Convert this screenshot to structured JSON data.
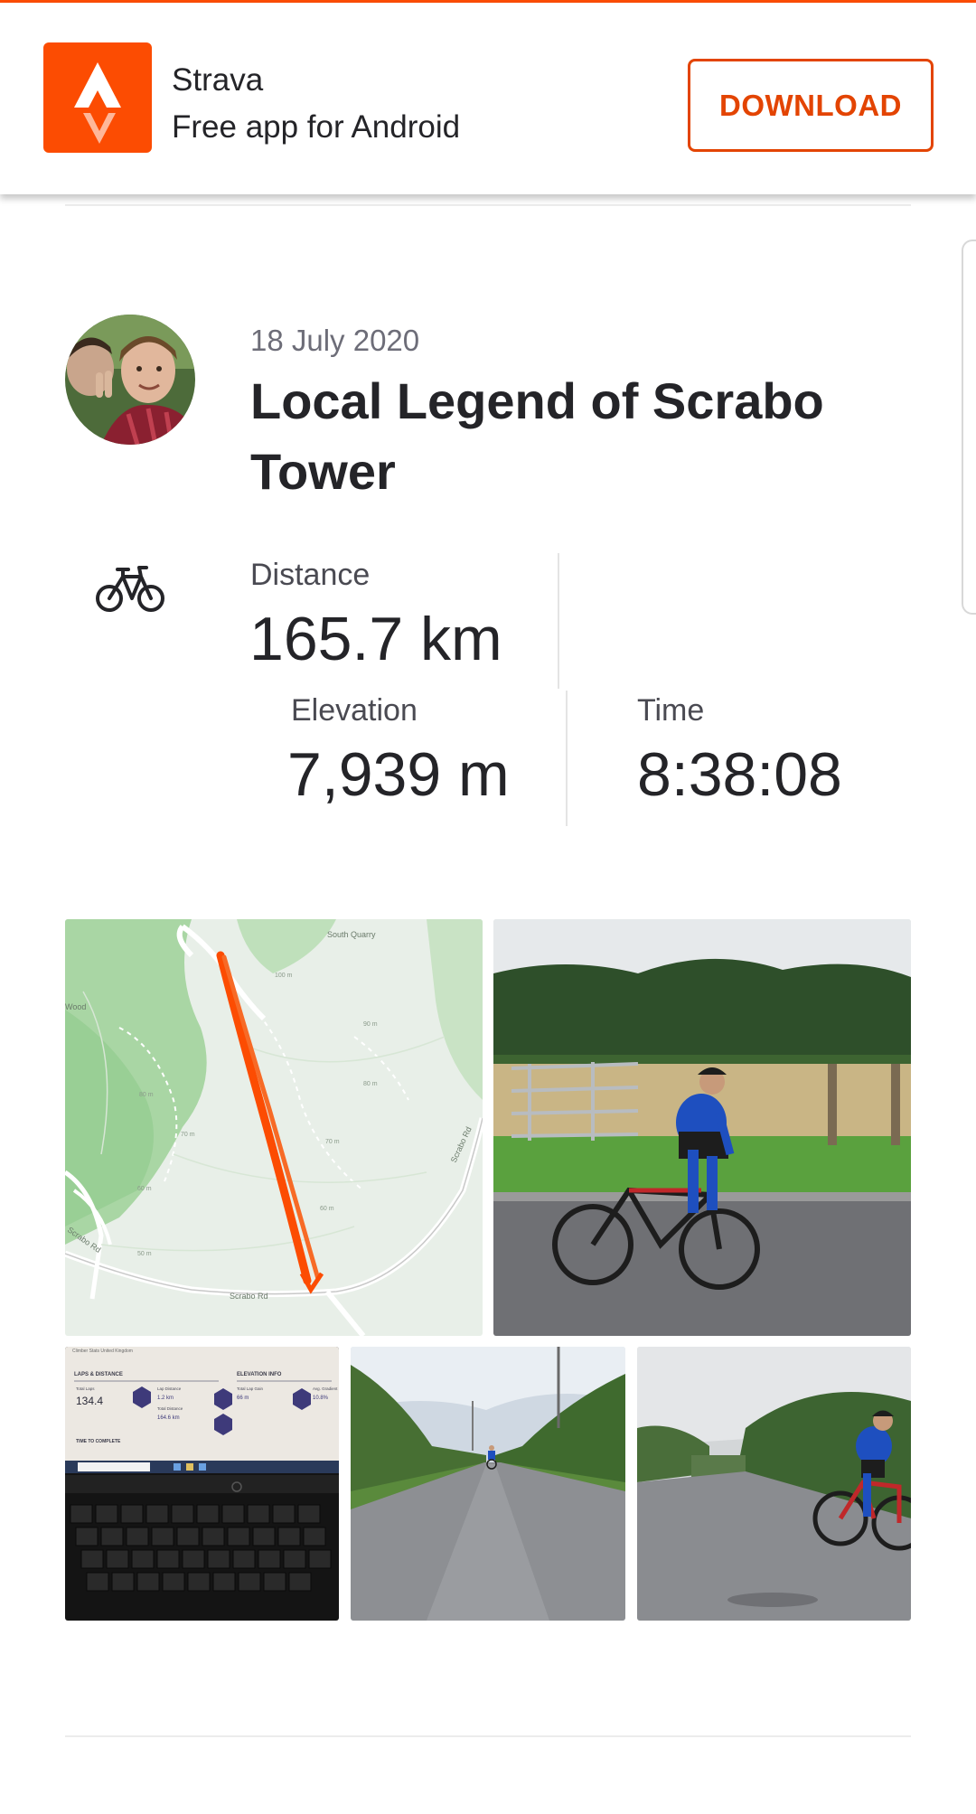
{
  "colors": {
    "accent": "#fc4c02",
    "button_text": "#e34402",
    "text": "#242428",
    "muted": "#6d6d78"
  },
  "banner": {
    "app_icon": "strava-logo-icon",
    "app_name": "Strava",
    "app_subtitle": "Free app for Android",
    "download_label": "DOWNLOAD"
  },
  "activity": {
    "avatar": "athlete-avatar",
    "date": "18 July 2020",
    "title": "Local Legend of Scrabo Tower",
    "sport_icon": "bicycle-icon",
    "stats": {
      "distance_label": "Distance",
      "distance_value": "165.7 km",
      "elevation_label": "Elevation",
      "elevation_value": "7,939 m",
      "time_label": "Time",
      "time_value": "8:38:08"
    }
  },
  "map": {
    "labels": [
      "South Quarry",
      "Wood",
      "Scrabo Rd",
      "Scrabo Rd",
      "Scrabo Rd"
    ],
    "contours": [
      "100 m",
      "90 m",
      "80 m",
      "70 m",
      "60 m",
      "80 m",
      "70 m",
      "60 m",
      "50 m"
    ]
  },
  "media": [
    {
      "name": "route-map",
      "icon": "map-thumbnail"
    },
    {
      "name": "photo-cyclist-gate",
      "icon": "photo-thumbnail"
    },
    {
      "name": "photo-laptop-stats",
      "icon": "photo-thumbnail"
    },
    {
      "name": "photo-lane-distant-cyclist",
      "icon": "photo-thumbnail"
    },
    {
      "name": "photo-cyclist-lane",
      "icon": "photo-thumbnail"
    }
  ],
  "laptop_screen": {
    "header": "Climber Stats United Kingdom",
    "laps_heading": "LAPS & DISTANCE",
    "elevation_heading": "ELEVATION INFO",
    "total_laps_label": "Total Laps",
    "total_laps_value": "134.4",
    "lap_distance_label": "Lap Distance",
    "lap_distance_value": "1.2 km",
    "total_distance_label": "Total Distance",
    "total_distance_value": "164.6 km",
    "total_lap_gain_label": "Total Lap Gain",
    "total_lap_gain_value": "66 m",
    "avg_gradient_label": "Avg. Gradient",
    "avg_gradient_value": "10.8%",
    "time_heading": "TIME TO COMPLETE"
  }
}
